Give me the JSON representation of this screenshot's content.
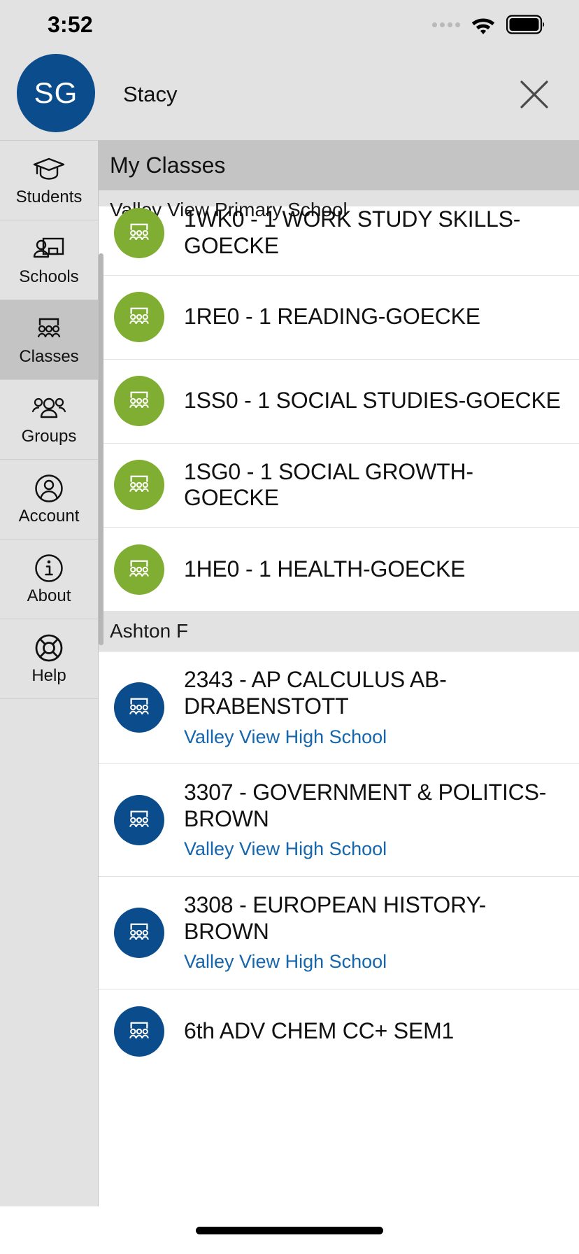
{
  "status_bar": {
    "time": "3:52",
    "signal_icon": "signal-dots-icon",
    "wifi_icon": "wifi-icon",
    "battery_icon": "battery-full-icon"
  },
  "account_header": {
    "avatar_initials": "SG",
    "avatar_color": "#0b4d8c",
    "user_name": "Stacy",
    "close_icon": "close-icon"
  },
  "sidebar": {
    "items": [
      {
        "label": "Students",
        "icon": "graduation-cap-icon",
        "active": false
      },
      {
        "label": "Schools",
        "icon": "school-board-icon",
        "active": false
      },
      {
        "label": "Classes",
        "icon": "classroom-icon",
        "active": true
      },
      {
        "label": "Groups",
        "icon": "people-group-icon",
        "active": false
      },
      {
        "label": "Account",
        "icon": "user-circle-icon",
        "active": false
      },
      {
        "label": "About",
        "icon": "info-circle-icon",
        "active": false
      },
      {
        "label": "Help",
        "icon": "lifebuoy-icon",
        "active": false
      }
    ]
  },
  "content": {
    "title": "My Classes",
    "sections": [
      {
        "header": "Valley View Primary School",
        "rows": [
          {
            "title": "1WK0 - 1 WORK STUDY SKILLS-GOECKE",
            "subtitle": "",
            "icon": "classroom-icon",
            "color": "green",
            "clipped": "top"
          },
          {
            "title": "1RE0 - 1 READING-GOECKE",
            "subtitle": "",
            "icon": "classroom-icon",
            "color": "green"
          },
          {
            "title": "1SS0 - 1 SOCIAL STUDIES-GOECKE",
            "subtitle": "",
            "icon": "classroom-icon",
            "color": "green"
          },
          {
            "title": "1SG0 - 1 SOCIAL GROWTH-GOECKE",
            "subtitle": "",
            "icon": "classroom-icon",
            "color": "green"
          },
          {
            "title": "1HE0 - 1 HEALTH-GOECKE",
            "subtitle": "",
            "icon": "classroom-icon",
            "color": "green"
          }
        ]
      },
      {
        "header": "Ashton F",
        "rows": [
          {
            "title": "2343 - AP CALCULUS AB-DRABENSTOTT",
            "subtitle": "Valley View High School",
            "icon": "classroom-icon",
            "color": "blue"
          },
          {
            "title": "3307 - GOVERNMENT & POLITICS-BROWN",
            "subtitle": "Valley View High School",
            "icon": "classroom-icon",
            "color": "blue"
          },
          {
            "title": "3308 - EUROPEAN HISTORY-BROWN",
            "subtitle": "Valley View High School",
            "icon": "classroom-icon",
            "color": "blue"
          },
          {
            "title": "6th ADV CHEM CC+ SEM1",
            "subtitle": "",
            "icon": "classroom-icon",
            "color": "blue",
            "clipped": "bottom"
          }
        ]
      }
    ]
  },
  "colors": {
    "brand_blue": "#0b4d8c",
    "brand_green": "#7fae33",
    "link_blue": "#1566ad",
    "chrome_gray": "#e2e2e2",
    "header_gray": "#c4c4c4"
  },
  "home_indicator": "home-indicator"
}
